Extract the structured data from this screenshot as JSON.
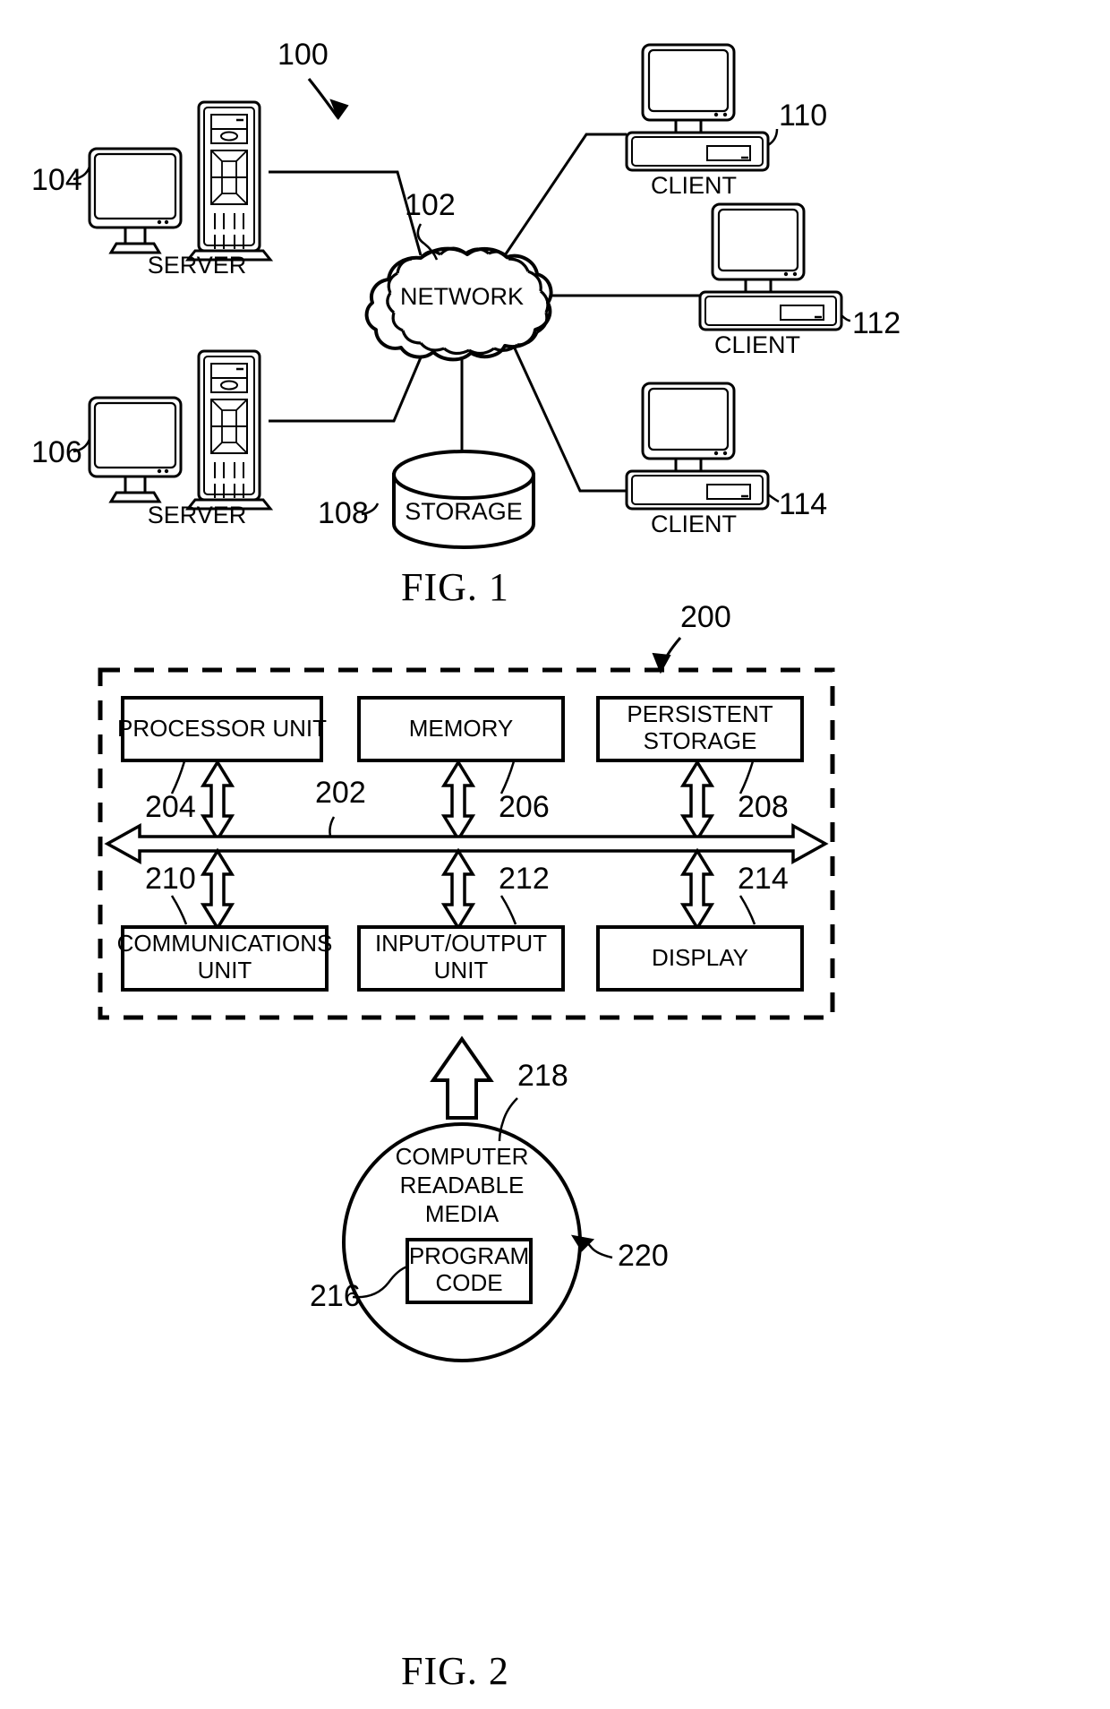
{
  "document": {
    "type": "patent-drawing-sheet",
    "figures": [
      {
        "id": "fig1",
        "caption": "FIG. 1",
        "system_ref": "100",
        "nodes": [
          {
            "ref": "104",
            "label": "SERVER",
            "kind": "server-workstation"
          },
          {
            "ref": "106",
            "label": "SERVER",
            "kind": "server-workstation"
          },
          {
            "ref": "102",
            "label": "NETWORK",
            "kind": "cloud"
          },
          {
            "ref": "108",
            "label": "STORAGE",
            "kind": "cylinder"
          },
          {
            "ref": "110",
            "label": "CLIENT",
            "kind": "desktop-computer"
          },
          {
            "ref": "112",
            "label": "CLIENT",
            "kind": "desktop-computer"
          },
          {
            "ref": "114",
            "label": "CLIENT",
            "kind": "desktop-computer"
          }
        ],
        "connections": [
          {
            "from": "104",
            "to": "102"
          },
          {
            "from": "106",
            "to": "102"
          },
          {
            "from": "102",
            "to": "108"
          },
          {
            "from": "102",
            "to": "110"
          },
          {
            "from": "102",
            "to": "112"
          },
          {
            "from": "102",
            "to": "114"
          }
        ]
      },
      {
        "id": "fig2",
        "caption": "FIG. 2",
        "system_ref": "200",
        "bus_ref": "202",
        "boxes_top": [
          {
            "ref": "204",
            "label": "PROCESSOR UNIT"
          },
          {
            "ref": "206",
            "label": "MEMORY"
          },
          {
            "ref": "208",
            "label": "PERSISTENT STORAGE",
            "line1": "PERSISTENT",
            "line2": "STORAGE"
          }
        ],
        "boxes_bottom": [
          {
            "ref": "210",
            "label": "COMMUNICATIONS UNIT",
            "line1": "COMMUNICATIONS",
            "line2": "UNIT"
          },
          {
            "ref": "212",
            "label": "INPUT/OUTPUT UNIT",
            "line1": "INPUT/OUTPUT",
            "line2": "UNIT"
          },
          {
            "ref": "214",
            "label": "DISPLAY",
            "line1": "DISPLAY",
            "line2": ""
          }
        ],
        "media": {
          "ref": "218",
          "outer_ref": "220",
          "label_line1": "COMPUTER",
          "label_line2": "READABLE",
          "label_line3": "MEDIA",
          "program": {
            "ref": "216",
            "line1": "PROGRAM",
            "line2": "CODE"
          }
        }
      }
    ]
  },
  "colors": {
    "ink": "#000000",
    "paper": "#ffffff"
  }
}
